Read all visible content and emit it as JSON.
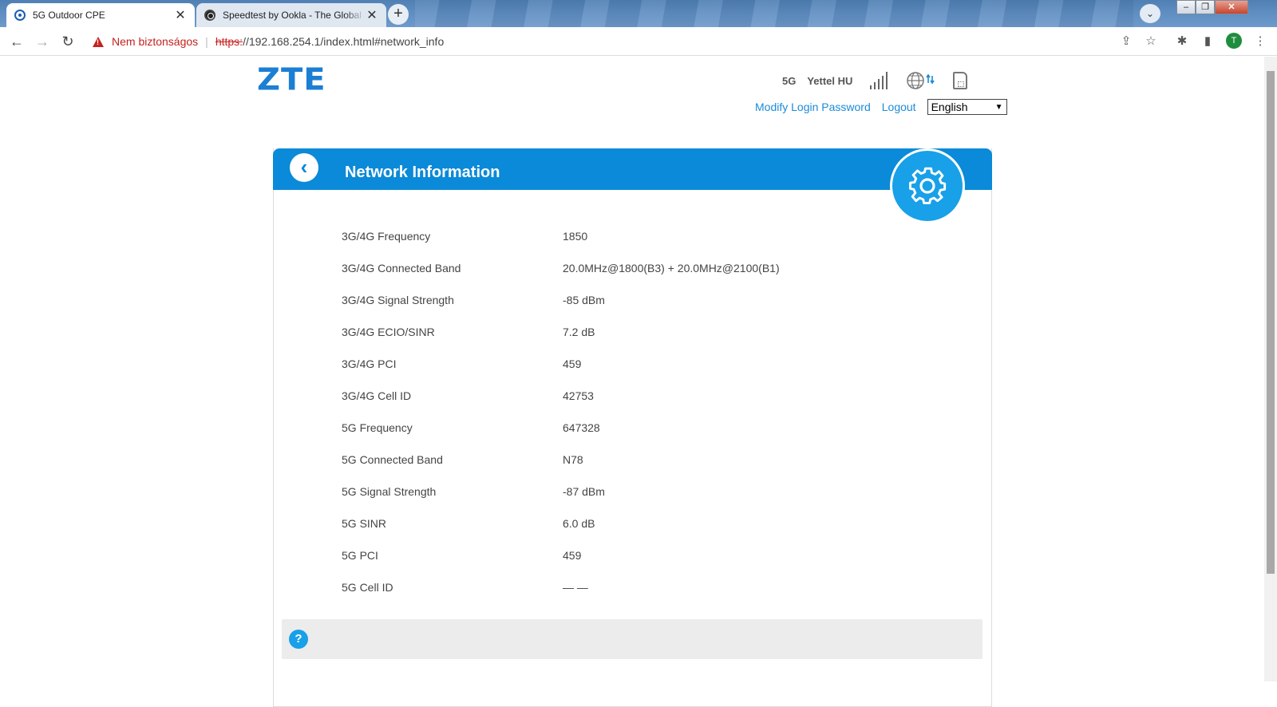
{
  "browser": {
    "tabs": [
      {
        "title": "5G Outdoor CPE",
        "active": true
      },
      {
        "title": "Speedtest by Ookla - The Global Broadband Speed Test",
        "active": false
      }
    ],
    "new_tab_label": "+",
    "security_label": "Nem biztonságos",
    "url_scheme": "https:",
    "url_rest": "//192.168.254.1/index.html#network_info",
    "profile_initial": "T"
  },
  "header": {
    "logo": "ZTE",
    "network_type": "5G",
    "operator": "Yettel HU",
    "modify_password_link": "Modify Login Password",
    "logout_link": "Logout",
    "language": {
      "selected": "English",
      "options": [
        "English"
      ]
    }
  },
  "panel": {
    "title": "Network Information",
    "back_glyph": "‹",
    "help_glyph": "?"
  },
  "network_info": [
    {
      "label": "3G/4G Frequency",
      "value": "1850"
    },
    {
      "label": "3G/4G Connected Band",
      "value": "20.0MHz@1800(B3) + 20.0MHz@2100(B1)"
    },
    {
      "label": "3G/4G Signal Strength",
      "value": "-85 dBm"
    },
    {
      "label": "3G/4G ECIO/SINR",
      "value": "7.2 dB"
    },
    {
      "label": "3G/4G PCI",
      "value": "459"
    },
    {
      "label": "3G/4G Cell ID",
      "value": "42753"
    },
    {
      "label": "5G Frequency",
      "value": "647328"
    },
    {
      "label": "5G Connected Band",
      "value": "N78"
    },
    {
      "label": "5G Signal Strength",
      "value": "-87 dBm"
    },
    {
      "label": "5G SINR",
      "value": "6.0 dB"
    },
    {
      "label": "5G PCI",
      "value": "459"
    },
    {
      "label": "5G Cell ID",
      "value": "— —"
    }
  ],
  "colors": {
    "accent": "#0a8ad8",
    "badge": "#18a0e8",
    "link": "#1b8bd9",
    "logo": "#1b7fd4",
    "warning": "#c5221f"
  }
}
